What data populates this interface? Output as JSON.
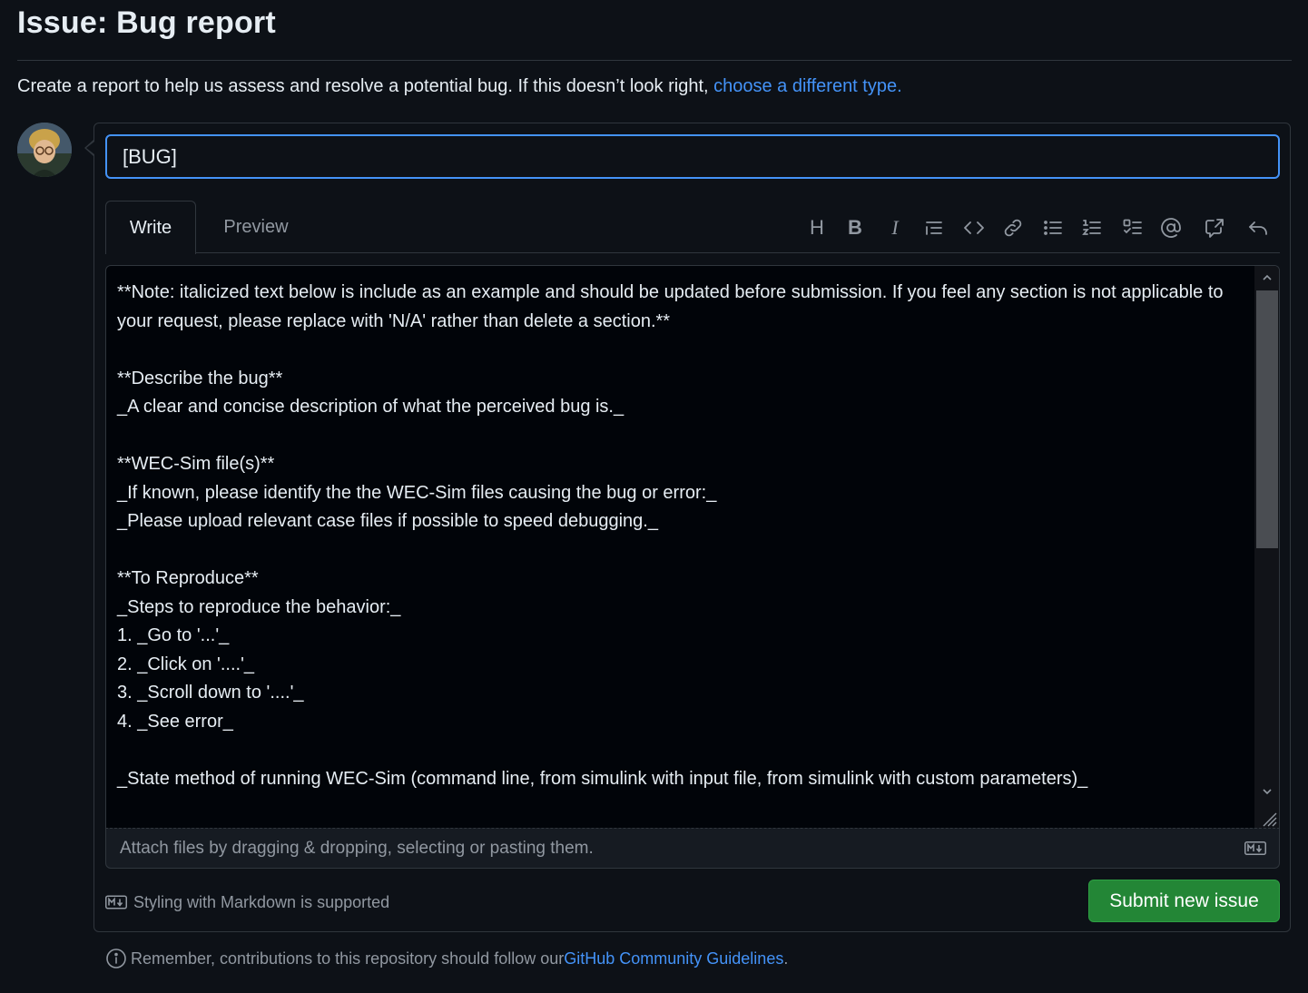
{
  "header": {
    "title": "Issue: Bug report",
    "intro_text": "Create a report to help us assess and resolve a potential bug. If this doesn’t look right, ",
    "intro_link": "choose a different type."
  },
  "form": {
    "title_value": "[BUG]",
    "tabs": [
      {
        "label": "Write",
        "active": true
      },
      {
        "label": "Preview",
        "active": false
      }
    ],
    "toolbar": [
      {
        "name": "heading-icon",
        "glyph": "H"
      },
      {
        "name": "bold-icon",
        "glyph": "B"
      },
      {
        "name": "italic-icon",
        "glyph": "I"
      },
      {
        "name": "quote-icon"
      },
      {
        "name": "code-icon"
      },
      {
        "name": "link-icon"
      },
      {
        "name": "unordered-list-icon"
      },
      {
        "name": "ordered-list-icon"
      },
      {
        "name": "task-list-icon"
      },
      {
        "name": "mention-icon"
      },
      {
        "name": "cross-reference-icon"
      },
      {
        "name": "undo-icon"
      }
    ],
    "body_value": "**Note: italicized text below is include as an example and should be updated before submission. If you feel any section is not applicable to your request, please replace with 'N/A' rather than delete a section.**\n\n**Describe the bug**\n_A clear and concise description of what the perceived bug is._\n\n**WEC-Sim file(s)**\n_If known, please identify the the WEC-Sim files causing the bug or error:_\n_Please upload relevant case files if possible to speed debugging._\n\n**To Reproduce**\n_Steps to reproduce the behavior:_\n1. _Go to '...'_\n2. _Click on '....'_\n3. _Scroll down to '....'_\n4. _See error_\n\n_State method of running WEC-Sim (command line, from simulink with input file, from simulink with custom parameters)_",
    "attach_text": "Attach files by dragging & dropping, selecting or pasting them.",
    "markdown_note": "Styling with Markdown is supported",
    "submit_label": "Submit new issue"
  },
  "footer": {
    "text": "Remember, contributions to this repository should follow our ",
    "link": "GitHub Community Guidelines",
    "suffix": "."
  },
  "colors": {
    "background": "#0d1117",
    "accent": "#4493f8",
    "submit": "#238636",
    "border": "#30363d",
    "muted": "#9198a1"
  }
}
